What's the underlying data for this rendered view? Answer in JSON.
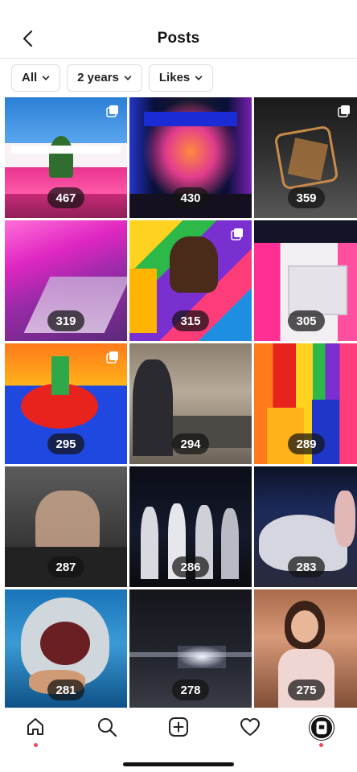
{
  "header": {
    "title": "Posts"
  },
  "filters": [
    {
      "label": "All"
    },
    {
      "label": "2 years"
    },
    {
      "label": "Likes"
    }
  ],
  "posts": [
    {
      "count": "467",
      "multi": true
    },
    {
      "count": "430",
      "multi": false
    },
    {
      "count": "359",
      "multi": true
    },
    {
      "count": "319",
      "multi": false
    },
    {
      "count": "315",
      "multi": true
    },
    {
      "count": "305",
      "multi": false
    },
    {
      "count": "295",
      "multi": true
    },
    {
      "count": "294",
      "multi": false
    },
    {
      "count": "289",
      "multi": false
    },
    {
      "count": "287",
      "multi": false
    },
    {
      "count": "286",
      "multi": false
    },
    {
      "count": "283",
      "multi": false
    },
    {
      "count": "281",
      "multi": false
    },
    {
      "count": "278",
      "multi": false
    },
    {
      "count": "275",
      "multi": false
    }
  ],
  "tabs": [
    {
      "icon": "home-icon",
      "active_dot": true
    },
    {
      "icon": "search-icon",
      "active_dot": false
    },
    {
      "icon": "add-post-icon",
      "active_dot": false
    },
    {
      "icon": "heart-icon",
      "active_dot": false
    },
    {
      "icon": "profile-avatar",
      "active_dot": true
    }
  ],
  "colors": {
    "notification_dot": "#ed4956",
    "badge_bg": "#141414"
  }
}
